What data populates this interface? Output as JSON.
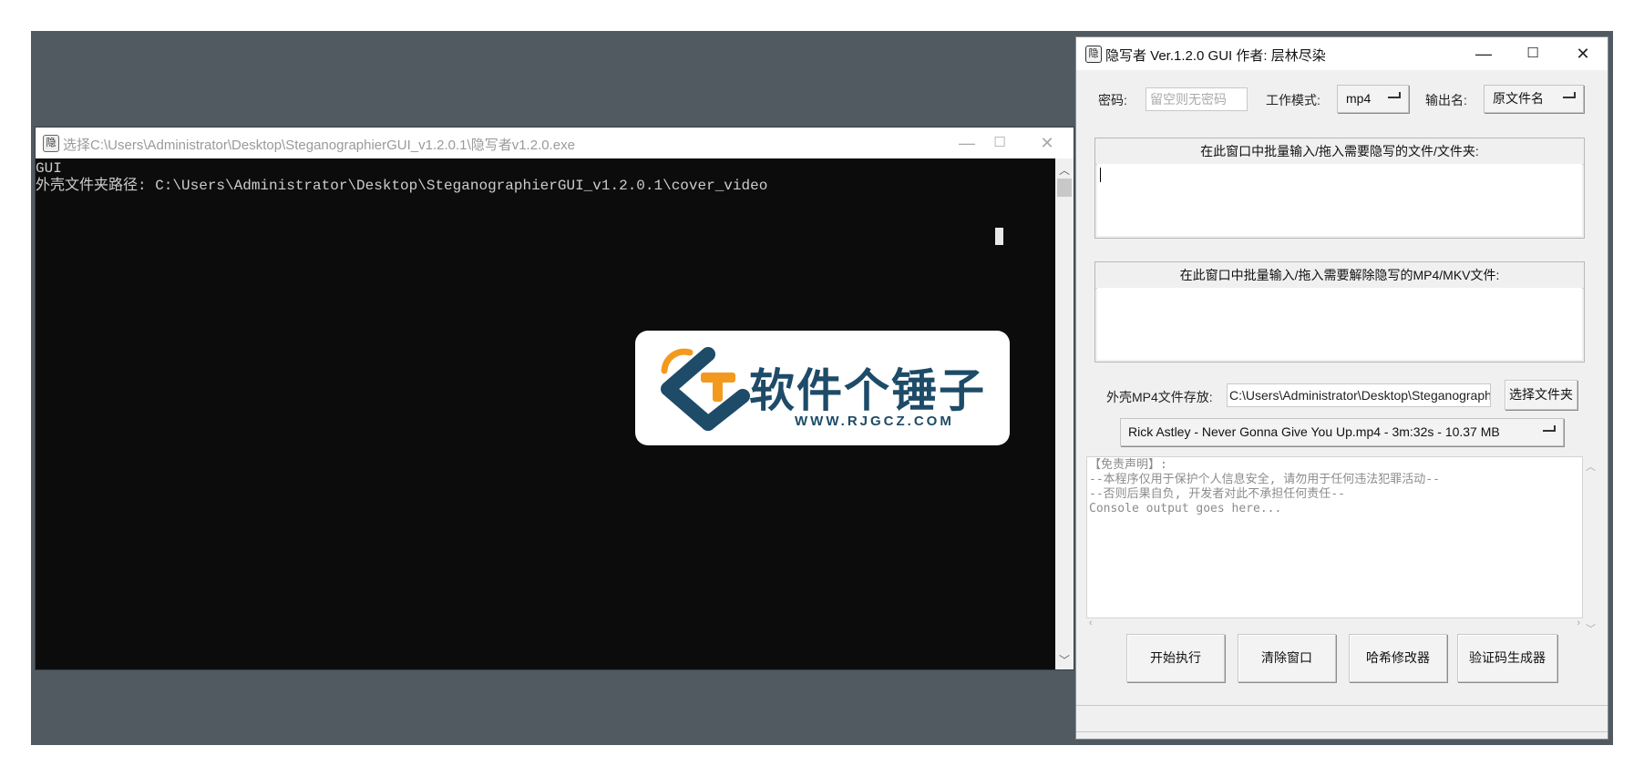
{
  "console_window": {
    "title": "选择C:\\Users\\Administrator\\Desktop\\SteganographierGUI_v1.2.0.1\\隐写者v1.2.0.exe",
    "lines": [
      "GUI",
      "外壳文件夹路径: C:\\Users\\Administrator\\Desktop\\SteganographierGUI_v1.2.0.1\\cover_video"
    ]
  },
  "watermark": {
    "name": "软件个锤子",
    "url": "WWW.RJGCZ.COM"
  },
  "gui_window": {
    "title": "隐写者 Ver.1.2.0 GUI 作者: 层林尽染",
    "password_label": "密码:",
    "password_placeholder": "留空则无密码",
    "mode_label": "工作模式:",
    "mode_value": "mp4",
    "output_label": "输出名:",
    "output_value": "原文件名",
    "hide_header": "在此窗口中批量输入/拖入需要隐写的文件/文件夹:",
    "reveal_header": "在此窗口中批量输入/拖入需要解除隐写的MP4/MKV文件:",
    "cover_label": "外壳MP4文件存放:",
    "cover_path": "C:\\Users\\Administrator\\Desktop\\Steganographier",
    "choose_folder": "选择文件夹",
    "cover_file": "Rick Astley - Never Gonna Give You Up.mp4 - 3m:32s - 10.37 MB",
    "log_lines": [
      "【免责声明】:",
      "--本程序仅用于保护个人信息安全, 请勿用于任何违法犯罪活动--",
      "--否则后果自负, 开发者对此不承担任何责任--",
      "Console output goes here..."
    ],
    "buttons": {
      "start": "开始执行",
      "clear": "清除窗口",
      "hash": "哈希修改器",
      "captcha": "验证码生成器"
    }
  },
  "colors": {
    "desktop": "#515961",
    "console_bg": "#0c0c0c",
    "watermark_text": "#1d4b68",
    "watermark_accent": "#f39a1e"
  }
}
